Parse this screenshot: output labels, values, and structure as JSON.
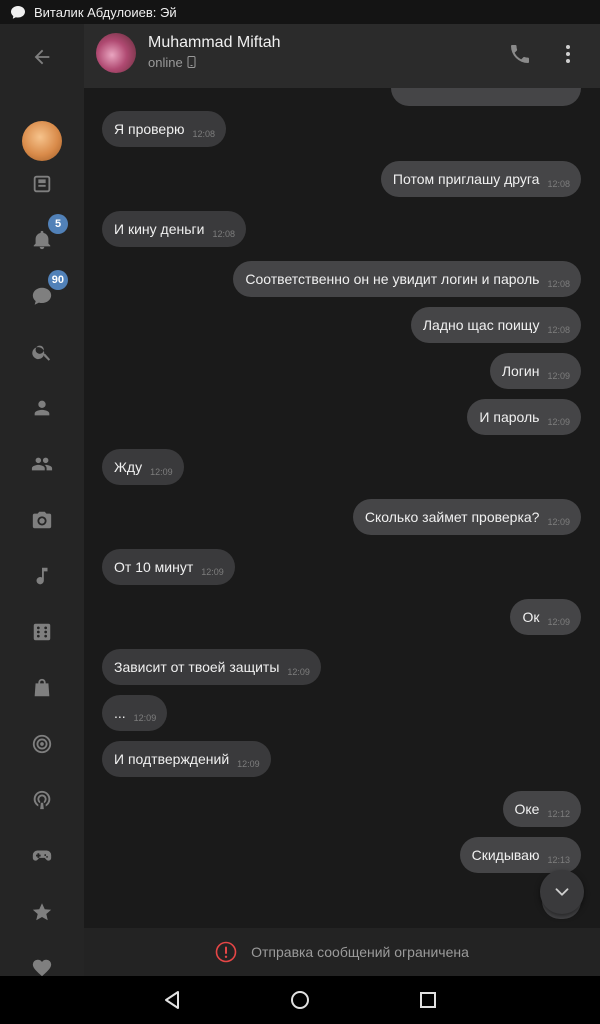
{
  "status_bar": {
    "notification": "Виталик Абдулоиев: Эй"
  },
  "sidebar": {
    "items": [
      {
        "name": "back-arrow-icon"
      },
      {
        "name": "avatar"
      },
      {
        "name": "news-icon"
      },
      {
        "name": "bell-icon",
        "badge": "5"
      },
      {
        "name": "chat-icon",
        "badge": "90"
      },
      {
        "name": "search-icon"
      },
      {
        "name": "person-icon"
      },
      {
        "name": "friends-icon"
      },
      {
        "name": "camera-icon"
      },
      {
        "name": "music-icon"
      },
      {
        "name": "apps-icon"
      },
      {
        "name": "shop-icon"
      },
      {
        "name": "target-icon"
      },
      {
        "name": "podcast-icon"
      },
      {
        "name": "gamepad-icon"
      },
      {
        "name": "star-icon"
      },
      {
        "name": "heart-icon"
      }
    ]
  },
  "header": {
    "name": "Muhammad Miftah",
    "status": "online"
  },
  "messages": [
    {
      "text": "Я проверю",
      "time": "12:08",
      "dir": "in"
    },
    {
      "text": "Потом приглашу друга",
      "time": "12:08",
      "dir": "out"
    },
    {
      "text": "И кину деньги",
      "time": "12:08",
      "dir": "in"
    },
    {
      "text": "Соответственно он не увидит логин и пароль",
      "time": "12:08",
      "dir": "out"
    },
    {
      "text": "Ладно щас поищу",
      "time": "12:08",
      "dir": "out"
    },
    {
      "text": "Логин",
      "time": "12:09",
      "dir": "out"
    },
    {
      "text": "И пароль",
      "time": "12:09",
      "dir": "out"
    },
    {
      "text": "Жду",
      "time": "12:09",
      "dir": "in"
    },
    {
      "text": "Сколько займет проверка?",
      "time": "12:09",
      "dir": "out"
    },
    {
      "text": "От 10 минут",
      "time": "12:09",
      "dir": "in"
    },
    {
      "text": "Ок",
      "time": "12:09",
      "dir": "out"
    },
    {
      "text": "Зависит от твоей защиты",
      "time": "12:09",
      "dir": "in"
    },
    {
      "text": "...",
      "time": "12:09",
      "dir": "in"
    },
    {
      "text": "И подтверждений",
      "time": "12:09",
      "dir": "in"
    },
    {
      "text": "Оке",
      "time": "12:12",
      "dir": "out"
    },
    {
      "text": "Скидываю",
      "time": "12:13",
      "dir": "out"
    },
    {
      "text": "?",
      "time": "",
      "dir": "out"
    }
  ],
  "composer": {
    "notice": "Отправка сообщений ограничена"
  },
  "colors": {
    "accent": "#5181b8",
    "bubble_in": "#3a3a3c",
    "bubble_out": "#454547",
    "warning": "#e64646"
  }
}
